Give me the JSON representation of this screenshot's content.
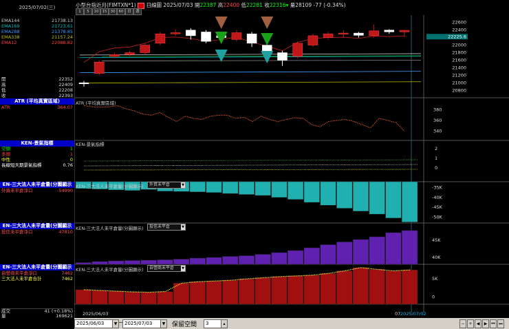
{
  "sidebar": {
    "date": "2025/07/02(三)",
    "ema": [
      {
        "label": "EMA144",
        "value": "21738.13",
        "color": "#cccccc"
      },
      {
        "label": "EMA169",
        "value": "21723.61",
        "color": "#00c0c0"
      },
      {
        "label": "EMA288",
        "value": "21378.85",
        "color": "#3c9dff"
      },
      {
        "label": "EMA338",
        "value": "21157.24",
        "color": "#c0c000"
      },
      {
        "label": "EMA12",
        "value": "22088.82",
        "color": "#ff4040"
      }
    ],
    "ohlc": [
      {
        "label": "開",
        "value": "22352"
      },
      {
        "label": "高",
        "value": "22409"
      },
      {
        "label": "低",
        "value": "22208"
      },
      {
        "label": "收",
        "value": "22393"
      }
    ],
    "atr_header": "ATR (平均真實區域)",
    "atr_label": "ATR",
    "atr_value": "364.07",
    "ken_header": "KEN-景氣指標",
    "ken_rows": [
      {
        "label": "空頭",
        "value": "1",
        "color": "#00ff00"
      },
      {
        "label": "多頭",
        "value": "1",
        "color": "#ff4040"
      },
      {
        "label": "中性",
        "value": "0",
        "color": "#ffff00"
      },
      {
        "label": "長線短天期景氣指標",
        "value": "0.76",
        "color": "#ffffff"
      }
    ],
    "inst1_header": "EN-三大法人未平倉量(分圖顯示",
    "inst1_label": "外資未平倉淨口",
    "inst1_value": "-54990",
    "inst2_header": "EN-三大法人未平倉量(分圖顯示",
    "inst2_label": "投信未平倉淨口",
    "inst2_value": "47810",
    "inst3_header": "EN-三大法人未平倉量(分圖顯示",
    "inst3_label1": "自營商未平倉淨口",
    "inst3_value1": "7462",
    "inst3_label2": "三大法人未平倉合計",
    "inst3_value2": "7462",
    "vol_label": "成交",
    "vol_value": "41 (+0.18%)",
    "oi_label": "量",
    "oi_value": "169621"
  },
  "topbar": {
    "title": "小型台指近月(FIMTXN*1)",
    "chart_mode": "日線圖",
    "date": "2025/07/03",
    "open_label": "開",
    "open": "22387",
    "high_label": "高",
    "high": "22400",
    "low_label": "低",
    "low": "22281",
    "close_label": "收",
    "close": "22316",
    "vol_label": "量",
    "vol": "28109",
    "change": "-77 (-0.34%)",
    "periods": [
      "1",
      "5",
      "10",
      "15",
      "30",
      "60",
      "日",
      "週"
    ]
  },
  "panels": {
    "atr_title": "ATR (平均真實區域)",
    "ken_title": "KEN-景氣指標",
    "inst1_title": "KEN-三大法人未平倉量(分圖顯示)",
    "inst1_select": "外資未平倉",
    "inst2_title": "KEN-三大法人未平倉量(分圖顯示)",
    "inst2_select": "投信未平倉",
    "inst3_title": "KEN-三大法人未平倉量(分圖顯示)",
    "inst3_select": "自營商未平倉"
  },
  "axis": {
    "price_ticks": [
      "22600",
      "22400",
      "22200",
      "22000",
      "21800",
      "21600",
      "21400",
      "21200",
      "21000",
      "20800"
    ],
    "price_last": "22225.6",
    "atr_ticks": [
      "360",
      "340",
      "380"
    ],
    "ken_ticks": [
      "2",
      "1",
      "0"
    ],
    "inst1_ticks": [
      "-35K",
      "-40K",
      "-45K",
      "-50K"
    ],
    "inst2_ticks": [
      "45K",
      "40K"
    ],
    "inst3_ticks": [
      "5K",
      "0"
    ],
    "x_start": "2025/06/03",
    "x_mid": "07",
    "x_end": "2025/07/02"
  },
  "bottombar": {
    "from": "2025/06/03",
    "to": "2025/07/03",
    "sep": "~",
    "keep_label": "保留空間",
    "keep_value": "3"
  },
  "chart_data": [
    {
      "type": "candlestick",
      "title": "小型台指近月(FIMTXN*1)",
      "ylim": [
        20750,
        22650
      ],
      "x": [
        "06/03",
        "06/04",
        "06/05",
        "06/06",
        "06/09",
        "06/10",
        "06/11",
        "06/12",
        "06/13",
        "06/16",
        "06/17",
        "06/18",
        "06/19",
        "06/20",
        "06/23",
        "06/24",
        "06/25",
        "06/26",
        "06/27",
        "06/30",
        "07/01",
        "07/02"
      ],
      "open": [
        21000,
        21250,
        21700,
        21750,
        21800,
        22050,
        22300,
        22400,
        22350,
        22250,
        22150,
        22300,
        22000,
        21800,
        21700,
        22000,
        22200,
        22300,
        22320,
        22250,
        22400,
        22352
      ],
      "close": [
        20980,
        21550,
        21750,
        21800,
        22000,
        22300,
        22330,
        22250,
        22100,
        22200,
        22330,
        22050,
        21850,
        21600,
        22050,
        22250,
        22300,
        22320,
        22260,
        22380,
        22352,
        22393
      ],
      "high": [
        21050,
        21600,
        21800,
        21850,
        22050,
        22350,
        22420,
        22450,
        22400,
        22300,
        22400,
        22350,
        22050,
        21850,
        22100,
        22300,
        22350,
        22400,
        22350,
        22550,
        22420,
        22409
      ],
      "low": [
        20900,
        21200,
        21650,
        21700,
        21750,
        22000,
        22250,
        22150,
        22050,
        22150,
        22100,
        21950,
        21750,
        21450,
        21650,
        21950,
        22150,
        22200,
        22200,
        22200,
        22300,
        22208
      ]
    },
    {
      "type": "line",
      "title": "ATR",
      "ylim": [
        330,
        390
      ],
      "values": [
        388,
        386,
        385,
        386,
        388,
        382,
        378,
        372,
        370,
        375,
        366,
        358,
        368,
        364,
        362,
        368,
        370,
        370,
        364,
        366,
        358,
        368,
        362,
        358,
        362,
        365,
        364,
        352,
        348,
        358,
        360,
        362,
        358,
        352,
        346,
        364,
        360,
        356,
        340
      ]
    },
    {
      "type": "bar",
      "title": "外資未平倉",
      "ylim": [
        -53000,
        -32000
      ],
      "values": [
        -35500,
        -35800,
        -36200,
        -36500,
        -36000,
        -36800,
        -37000,
        -37200,
        -37500,
        -38000,
        -38500,
        -39000,
        -40000,
        -41000,
        -42500,
        -44000,
        -45500,
        -47000,
        -48500,
        -50500,
        -52500
      ]
    },
    {
      "type": "bar",
      "title": "投信未平倉",
      "ylim": [
        38000,
        50000
      ],
      "values": [
        38500,
        38800,
        39000,
        39100,
        39200,
        39300,
        39500,
        39800,
        40000,
        40300,
        40500,
        40900,
        41400,
        42000,
        42800,
        43700,
        44500,
        45200,
        46000,
        47200,
        47810
      ]
    },
    {
      "type": "bar",
      "title": "自營商未平倉",
      "ylim": [
        -2000,
        9000
      ],
      "values": [
        2000,
        1800,
        1600,
        1400,
        1300,
        1500,
        3800,
        4200,
        4400,
        4600,
        5000,
        5300,
        5600,
        5800,
        6000,
        6500,
        7200,
        8100,
        7600,
        7200,
        7462
      ]
    }
  ]
}
